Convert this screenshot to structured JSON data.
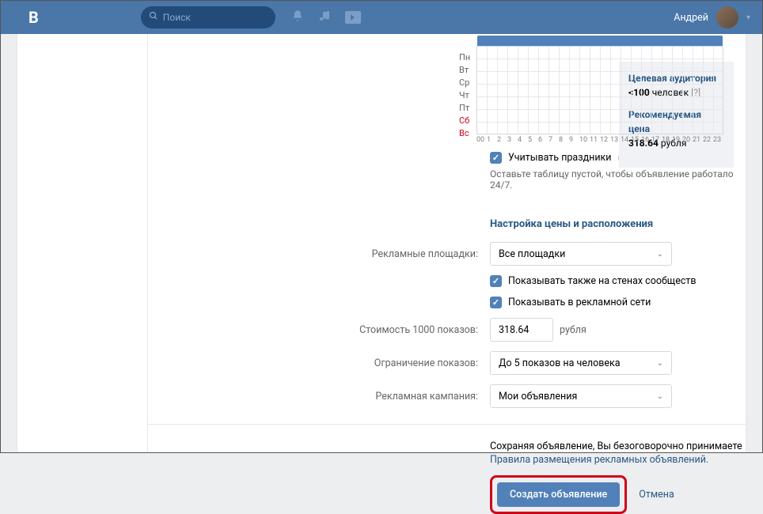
{
  "header": {
    "search_placeholder": "Поиск",
    "username": "Андрей"
  },
  "schedule": {
    "days": [
      "Пн",
      "Вт",
      "Ср",
      "Чт",
      "Пт",
      "Сб",
      "Вс"
    ],
    "hours": [
      "00",
      "1",
      "2",
      "3",
      "4",
      "5",
      "6",
      "7",
      "8",
      "9",
      "10",
      "11",
      "12",
      "13",
      "14",
      "15",
      "16",
      "17",
      "18",
      "19",
      "20",
      "21",
      "22",
      "23"
    ],
    "holidays_checkbox": "Учитывать праздники",
    "hint": "Оставьте таблицу пустой, чтобы объявление работало 24/7."
  },
  "pricing": {
    "section_title": "Настройка цены и расположения",
    "platforms_label": "Рекламные площадки:",
    "platforms_value": "Все площадки",
    "show_on_walls": "Показывать также на стенах сообществ",
    "show_in_network": "Показывать в рекламной сети",
    "cpm_label": "Стоимость 1000 показов:",
    "cpm_value": "318.64",
    "cpm_unit": "рубля",
    "limit_label": "Ограничение показов:",
    "limit_value": "До 5 показов на человека",
    "campaign_label": "Рекламная кампания:",
    "campaign_value": "Мои объявления"
  },
  "sidebar": {
    "audience_label": "Целевая аудитория",
    "audience_value": "<100",
    "audience_unit": "человек",
    "price_label": "Рекомендуемая цена",
    "price_value": "318.64",
    "price_unit": "рубля"
  },
  "footer": {
    "agree_text": "Сохраняя объявление, Вы безоговорочно принимаете",
    "rules_link": "Правила размещения рекламных объявлений.",
    "create_btn": "Создать объявление",
    "cancel": "Отмена"
  }
}
